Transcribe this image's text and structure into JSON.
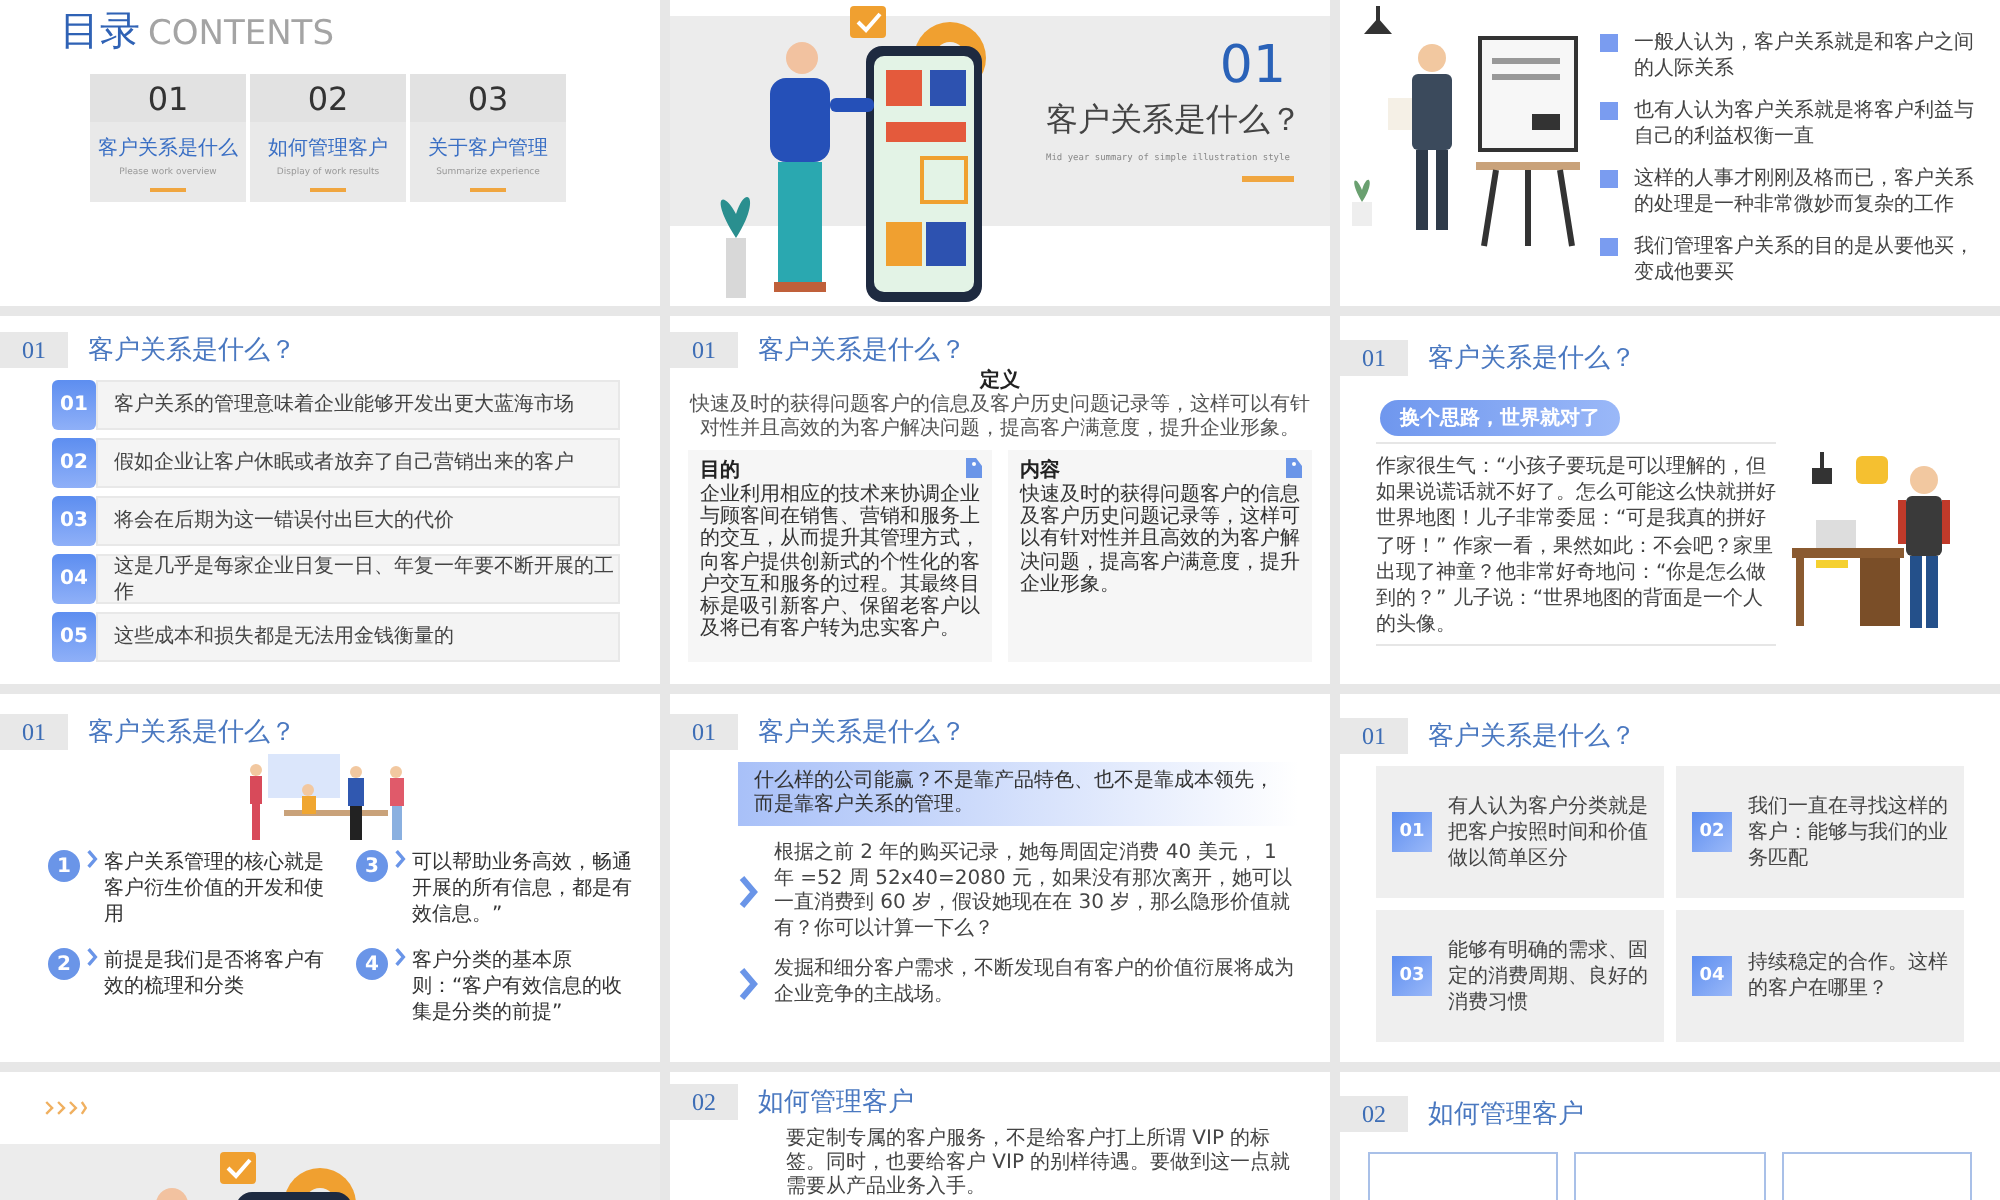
{
  "slides": [
    {
      "kind": "contents",
      "title": "目录",
      "title_en": "CONTENTS",
      "items": [
        {
          "number": "01",
          "label": "客户关系是什么",
          "caption": "Please work overview"
        },
        {
          "number": "02",
          "label": "如何管理客户",
          "caption": "Display of work results"
        },
        {
          "number": "03",
          "label": "关于客户管理",
          "caption": "Summarize experience"
        }
      ]
    },
    {
      "kind": "section",
      "number": "01",
      "title": "客户关系是什么？",
      "subtitle": "Mid year summary of simple illustration style"
    },
    {
      "kind": "bullets",
      "points": [
        "一般人认为，客户关系就是和客户之间的人际关系",
        "也有人认为客户关系就是将客户利益与自己的利益权衡一直",
        "这样的人事才刚刚及格而已，客户关系的处理是一种非常微妙而复杂的工作",
        "我们管理客户关系的目的是从要他买，变成他要买"
      ]
    },
    {
      "kind": "numbered_list",
      "section": "01",
      "title": "客户关系是什么？",
      "items": [
        {
          "number": "01",
          "text": "客户关系的管理意味着企业能够开发出更大蓝海市场"
        },
        {
          "number": "02",
          "text": "假如企业让客户休眠或者放弃了自己营销出来的客户"
        },
        {
          "number": "03",
          "text": "将会在后期为这一错误付出巨大的代价"
        },
        {
          "number": "04",
          "text": "这是几乎是每家企业日复一日、年复一年要不断开展的工作"
        },
        {
          "number": "05",
          "text": "这些成本和损失都是无法用金钱衡量的"
        }
      ]
    },
    {
      "kind": "definition",
      "section": "01",
      "title": "客户关系是什么？",
      "heading": "定义",
      "text": "快速及时的获得问题客户的信息及客户历史问题记录等，这样可以有针对性并且高效的为客户解决问题，提高客户满意度，提升企业形象。",
      "cards": [
        {
          "title": "目的",
          "text": "企业利用相应的技术来协调企业与顾客间在销售、营销和服务上的交互，从而提升其管理方式，向客户提供创新式的个性化的客户交互和服务的过程。其最终目标是吸引新客户、保留老客户以及将已有客户转为忠实客户。"
        },
        {
          "title": "内容",
          "text": "快速及时的获得问题客户的信息及客户历史问题记录等，这样可以有针对性并且高效的为客户解决问题，提高客户满意度，提升企业形象。"
        }
      ]
    },
    {
      "kind": "story",
      "section": "01",
      "title": "客户关系是什么？",
      "tagline": "换个思路，世界就对了",
      "text": "作家很生气：“小孩子要玩是可以理解的，但如果说谎话就不好了。怎么可能这么快就拼好世界地图！儿子非常委屈：“可是我真的拼好了呀！” 作家一看，果然如此：不会吧？家里出现了神童？他非常好奇地问：“你是怎么做到的？” 儿子说：“世界地图的背面是一个人的头像。"
    },
    {
      "kind": "circle_grid",
      "section": "01",
      "title": "客户关系是什么？",
      "items": [
        {
          "number": "1",
          "text": "客户关系管理的核心就是客户衍生价值的开发和使用"
        },
        {
          "number": "3",
          "text": "可以帮助业务高效，畅通开展的所有信息，都是有效信息。”"
        },
        {
          "number": "2",
          "text": "前提是我们是否将客户有效的梳理和分类"
        },
        {
          "number": "4",
          "text": "客户分类的基本原则：“客户有效信息的收集是分类的前提”"
        }
      ]
    },
    {
      "kind": "chevrons",
      "section": "01",
      "title": "客户关系是什么？",
      "banner": "什么样的公司能赢？不是靠产品特色、也不是靠成本领先，而是靠客户关系的管理。",
      "points": [
        "根据之前 2 年的购买记录，她每周固定消费 40 美元， 1 年 =52 周 52x40=2080 元，如果没有那次离开，她可以一直消费到 60 岁，假设她现在在 30 岁，那么隐形价值就有？你可以计算一下么？",
        "发掘和细分客户需求，不断发现自有客户的价值衍展将成为企业竞争的主战场。"
      ]
    },
    {
      "kind": "card_grid",
      "section": "01",
      "title": "客户关系是什么？",
      "items": [
        {
          "number": "01",
          "text": "有人认为客户分类就是把客户按照时间和价值做以简单区分"
        },
        {
          "number": "02",
          "text": "我们一直在寻找这样的客户：能够与我们的业务匹配"
        },
        {
          "number": "03",
          "text": "能够有明确的需求、固定的消费周期、良好的消费习惯"
        },
        {
          "number": "04",
          "text": "持续稳定的合作。这样的客户在哪里？"
        }
      ]
    },
    {
      "kind": "section_art"
    },
    {
      "kind": "intro",
      "section": "02",
      "title": "如何管理客户",
      "text": "要定制专属的客户服务，不是给客户打上所谓 VIP 的标签。同时，也要给客户 VIP 的别样待遇。要做到这一点就需要从产品业务入手。"
    },
    {
      "kind": "boxes",
      "section": "02",
      "title": "如何管理客户"
    }
  ]
}
